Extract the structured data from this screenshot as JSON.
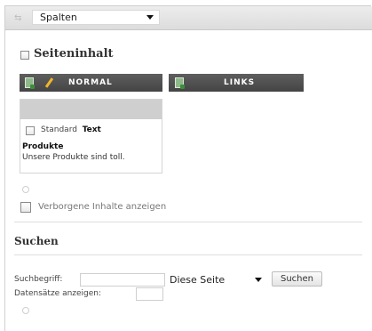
{
  "top_bar": {
    "column_select_value": "Spalten"
  },
  "content_section": {
    "title": "Seiteninhalt",
    "columns": [
      {
        "label": "NORMAL"
      },
      {
        "label": "LINKS"
      }
    ],
    "content_element": {
      "type_label": "Standard",
      "type_value": "Text",
      "title": "Produkte",
      "body": "Unsere Produkte sind toll."
    },
    "hidden_toggle_label": "Verborgene Inhalte anzeigen"
  },
  "search_section": {
    "title": "Suchen",
    "term_label": "Suchbegriff:",
    "term_value": "",
    "scope_value": "Diese Seite",
    "search_button_label": "Suchen",
    "records_label": "Datensätze anzeigen:",
    "records_value": ""
  }
}
